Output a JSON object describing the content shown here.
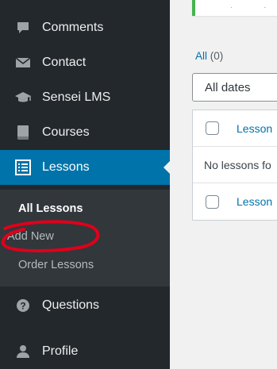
{
  "sidebar": {
    "items": [
      {
        "label": "Comments",
        "icon": "comment-bubble-icon"
      },
      {
        "label": "Contact",
        "icon": "envelope-icon"
      },
      {
        "label": "Sensei LMS",
        "icon": "graduation-cap-icon"
      },
      {
        "label": "Courses",
        "icon": "book-icon"
      },
      {
        "label": "Lessons",
        "icon": "list-icon",
        "active": true
      },
      {
        "label": "Questions",
        "icon": "question-circle-icon"
      },
      {
        "label": "Profile",
        "icon": "user-icon"
      }
    ],
    "submenu": [
      {
        "label": "All Lessons",
        "current": true
      },
      {
        "label": "Add New"
      },
      {
        "label": "Order Lessons"
      }
    ]
  },
  "content": {
    "filter": {
      "all_label": "All",
      "all_count": "(0)"
    },
    "date_select": {
      "value": "All dates"
    },
    "table": {
      "header_column": "Lesson",
      "empty_message": "No lessons fo",
      "footer_column": "Lesson"
    }
  },
  "colors": {
    "sidebar_bg": "#23282d",
    "submenu_bg": "#32373c",
    "active_bg": "#0073aa",
    "link": "#0073aa",
    "annotation": "#e0001a"
  }
}
